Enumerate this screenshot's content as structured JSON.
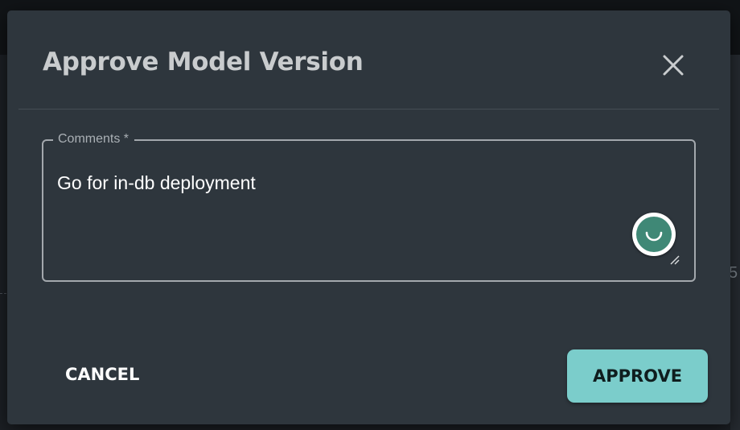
{
  "dialog": {
    "title": "Approve Model Version",
    "close_icon": "close-icon"
  },
  "comments_field": {
    "label": "Comments *",
    "value": "Go for in-db deployment",
    "assistant_icon": "writing-assistant-icon",
    "resize_icon": "resize-handle-icon"
  },
  "actions": {
    "cancel_label": "CANCEL",
    "approve_label": "APPROVE"
  },
  "background": {
    "partial_text": "5"
  },
  "colors": {
    "dialog_bg": "#2e363d",
    "title": "#c9ccce",
    "approve_button": "#7bcdcb",
    "assistant_badge": "#3f8876",
    "field_border": "#a3a8ad"
  }
}
